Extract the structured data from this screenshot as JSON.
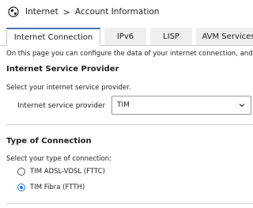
{
  "breadcrumb": {
    "root": "Internet",
    "separator": ">",
    "current": "Account Information"
  },
  "tabs": [
    {
      "label": "Internet Connection"
    },
    {
      "label": "IPv6"
    },
    {
      "label": "LISP"
    },
    {
      "label": "AVM Services"
    }
  ],
  "intro_text": "On this page you can configure the data of your internet connection, and adjust settings",
  "provider_section": {
    "heading": "Internet Service Provider",
    "prompt": "Select your internet service provider.",
    "field_label": "Internet service provider",
    "selected": "TIM"
  },
  "connection_section": {
    "heading": "Type of Connection",
    "prompt": "Select your type of connection:",
    "options": [
      {
        "label": "TIM ADSL-VDSL (FTTC)",
        "selected": false
      },
      {
        "label": "TIM Fibra (FTTH)",
        "selected": true
      }
    ]
  },
  "colors": {
    "accent": "#1a73e8",
    "tab_border": "#4a6fb3"
  }
}
